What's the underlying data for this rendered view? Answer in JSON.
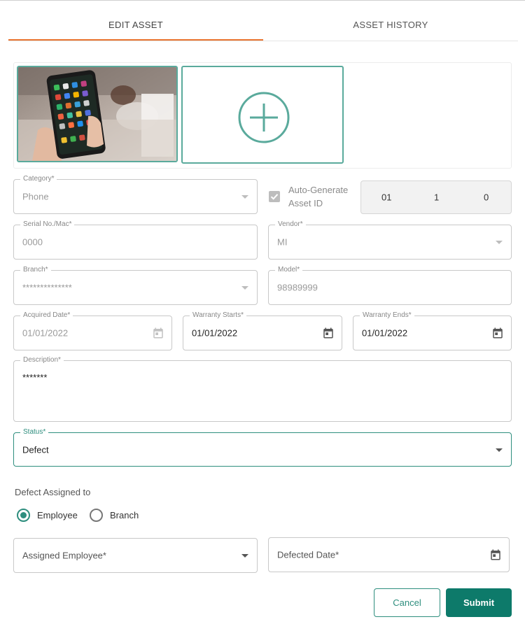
{
  "tabs": {
    "edit": "EDIT ASSET",
    "history": "ASSET HISTORY"
  },
  "category": {
    "label": "Category*",
    "value": "Phone"
  },
  "auto_generate": {
    "label": "Auto-Generate Asset ID",
    "checked": true,
    "parts": [
      "01",
      "1",
      "0"
    ]
  },
  "serial": {
    "label": "Serial No./Mac*",
    "value": "0000"
  },
  "vendor": {
    "label": "Vendor*",
    "value": "MI"
  },
  "branch": {
    "label": "Branch*",
    "value": "**************"
  },
  "model": {
    "label": "Model*",
    "value": "98989999"
  },
  "acquired": {
    "label": "Acquired Date*",
    "value": "01/01/2022"
  },
  "warranty_start": {
    "label": "Warranty Starts*",
    "value": "01/01/2022"
  },
  "warranty_end": {
    "label": "Warranty Ends*",
    "value": "01/01/2022"
  },
  "description": {
    "label": "Description*",
    "value": "*******"
  },
  "status": {
    "label": "Status*",
    "value": "Defect"
  },
  "defect": {
    "title": "Defect Assigned to",
    "options": [
      "Employee",
      "Branch"
    ],
    "selected": "Employee"
  },
  "assigned_employee": {
    "placeholder": "Assigned Employee*"
  },
  "defected_date": {
    "placeholder": "Defected Date*"
  },
  "actions": {
    "cancel": "Cancel",
    "submit": "Submit"
  },
  "colors": {
    "accent": "#0d7a6a",
    "tab_ink": "#e9732f",
    "thumb_border": "#5aaa9c"
  },
  "icons": {
    "add_photo": "plus-circle-icon",
    "calendar": "calendar-icon",
    "dropdown": "caret-down-icon",
    "checkbox": "check-icon"
  }
}
